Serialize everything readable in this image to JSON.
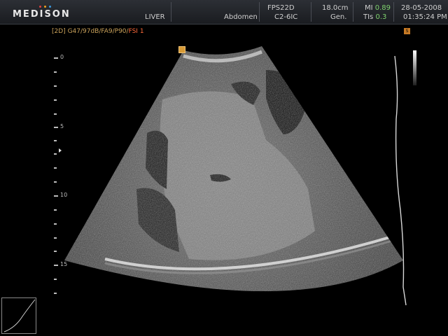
{
  "header": {
    "brand": "MEDISON",
    "brand_dot_colors": [
      "#e04040",
      "#f0a020",
      "#3a9ae0"
    ],
    "exam": "LIVER",
    "application": "Abdomen",
    "frame_setting": "FPS22D",
    "probe": "C2-6IC",
    "depth": "18.0cm",
    "frequency": "Gen.",
    "mi_label": "MI",
    "mi_value": "0.89",
    "tis_label": "TIs",
    "tis_value": "0.3",
    "date": "28-05-2008",
    "time": "01:35:24 PM"
  },
  "params": {
    "mode": "[2D]",
    "settings": "G47/97dB/FA9/P90/",
    "fsi": "FSI 1"
  },
  "markers": {
    "focus_icon": "focus-square-icon",
    "orientation_icon": "orientation-marker-icon",
    "orientation_label": "S"
  },
  "depth_scale": {
    "labels": [
      "0",
      "5",
      "10",
      "15"
    ]
  },
  "colors": {
    "header_bg": "#23262b",
    "green_value": "#7fd26e",
    "param_text": "#c9a15a",
    "fsi_text": "#ff6a3a"
  }
}
